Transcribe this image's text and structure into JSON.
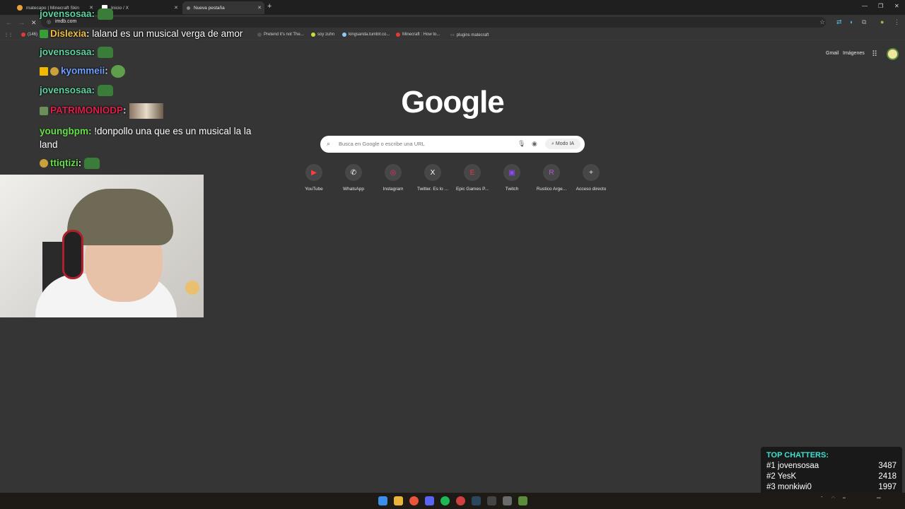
{
  "browser": {
    "tabs": [
      {
        "title": "matecapo | Minecraft Skin",
        "color": "#e8a03a"
      },
      {
        "title": "Inicio / X",
        "color": "#ffffff"
      },
      {
        "title": "Nueva pestaña",
        "color": "#888888"
      }
    ],
    "url": "imdb.com",
    "bookmarks": [
      {
        "label": "(146)",
        "color": "#e53935"
      },
      {
        "label": "Pretend it's not The...",
        "color": "#555555"
      },
      {
        "label": "soy zuhn",
        "color": "#cddc39"
      },
      {
        "label": "kingsanda.tumblr.co...",
        "color": "#90caf9"
      },
      {
        "label": "Minecraft : How to...",
        "color": "#e53935"
      },
      {
        "label": "plugins matecraft",
        "color": "#aaaaaa"
      }
    ]
  },
  "google": {
    "gmail": "Gmail",
    "images": "Imágenes",
    "logo": "Google",
    "search_placeholder": "Busca en Google o escribe una URL",
    "ai_mode": "Modo IA",
    "shortcuts": [
      {
        "label": "YouTube",
        "icon": "youtube-icon",
        "glyph": "▶",
        "color": "#ff3d3d"
      },
      {
        "label": "WhatsApp",
        "icon": "whatsapp-icon",
        "glyph": "✆",
        "color": "#ffffff"
      },
      {
        "label": "Instagram",
        "icon": "instagram-icon",
        "glyph": "◎",
        "color": "#e1306c"
      },
      {
        "label": "Twitter. Es lo ...",
        "icon": "x-icon",
        "glyph": "X",
        "color": "#ffffff"
      },
      {
        "label": "Epic Games P...",
        "icon": "epic-icon",
        "glyph": "E",
        "color": "#e53950"
      },
      {
        "label": "Twitch",
        "icon": "twitch-icon",
        "glyph": "▣",
        "color": "#9146ff"
      },
      {
        "label": "Rustico Arge...",
        "icon": "rustico-icon",
        "glyph": "R",
        "color": "#b05ad6"
      },
      {
        "label": "Acceso directo",
        "icon": "add-shortcut-icon",
        "glyph": "+",
        "color": "#e6e6e6"
      }
    ]
  },
  "chat": {
    "messages": [
      {
        "user": "jovensosaa",
        "color": "#5fd3a0",
        "text": ""
      },
      {
        "user": "Dislexia",
        "color": "#f0c040",
        "text": "laland es un musical verga de amor"
      },
      {
        "user": "jovensosaa",
        "color": "#5fd3a0",
        "text": ""
      },
      {
        "user": "kyommeii",
        "color": "#6f9fff",
        "text": ""
      },
      {
        "user": "jovensosaa",
        "color": "#5fd3a0",
        "text": ""
      },
      {
        "user": "PATRIMONIODP",
        "color": "#e0204a",
        "text": ""
      },
      {
        "user": "youngbpm",
        "color": "#66e04a",
        "text": "!donpollo una que es un musical la la land"
      },
      {
        "user": "ttiqtizi",
        "color": "#66e04a",
        "text": ""
      }
    ]
  },
  "top_chatters": {
    "title": "TOP CHATTERS:",
    "entries": [
      {
        "rank": "#1",
        "name": "jovensosaa",
        "count": "3487"
      },
      {
        "rank": "#2",
        "name": "YesK",
        "count": "2418"
      },
      {
        "rank": "#3",
        "name": "monkiwi0",
        "count": "1997"
      }
    ]
  }
}
